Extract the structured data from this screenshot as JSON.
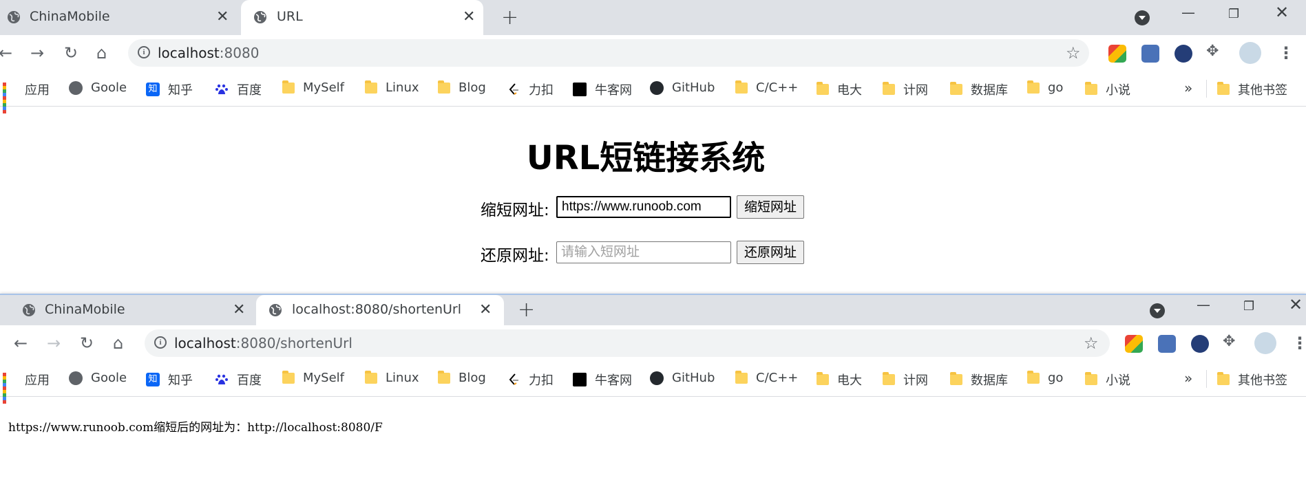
{
  "window1": {
    "tabs": [
      {
        "title": "ChinaMobile",
        "active": false
      },
      {
        "title": "URL",
        "active": true
      }
    ],
    "address": "localhost:8080",
    "page": {
      "title": "URL短链接系统",
      "shorten_label": "缩短网址:",
      "shorten_value": "https://www.runoob.com",
      "shorten_button": "缩短网址",
      "restore_label": "还原网址:",
      "restore_placeholder": "请输入短网址",
      "restore_button": "还原网址"
    }
  },
  "window2": {
    "tabs": [
      {
        "title": "ChinaMobile",
        "active": false
      },
      {
        "title": "localhost:8080/shortenUrl",
        "active": true
      }
    ],
    "address_host": "localhost",
    "address_rest": ":8080/shortenUrl",
    "result_text": "https://www.runoob.com缩短后的网址为：http://localhost:8080/F"
  },
  "bookmarks": [
    {
      "label": "应用",
      "icon": "apps-icon"
    },
    {
      "label": "Goole",
      "icon": "globe-icon"
    },
    {
      "label": "知乎",
      "icon": "zhihu-icon"
    },
    {
      "label": "百度",
      "icon": "baidu-icon"
    },
    {
      "label": "MySelf",
      "icon": "folder-icon"
    },
    {
      "label": "Linux",
      "icon": "folder-icon"
    },
    {
      "label": "Blog",
      "icon": "folder-icon"
    },
    {
      "label": "力扣",
      "icon": "leetcode-icon"
    },
    {
      "label": "牛客网",
      "icon": "nowcoder-icon"
    },
    {
      "label": "GitHub",
      "icon": "github-icon"
    },
    {
      "label": "C/C++",
      "icon": "folder-icon"
    },
    {
      "label": "电大",
      "icon": "folder-icon"
    },
    {
      "label": "计网",
      "icon": "folder-icon"
    },
    {
      "label": "数据库",
      "icon": "folder-icon"
    },
    {
      "label": "go",
      "icon": "folder-icon"
    },
    {
      "label": "小说",
      "icon": "folder-icon"
    }
  ],
  "bookmarks_more": "»",
  "other_bookmarks": "其他书签",
  "window1_address_host": "localhost",
  "window1_address_rest": ":8080",
  "zhihu_glyph": "知",
  "info_glyph": "i"
}
